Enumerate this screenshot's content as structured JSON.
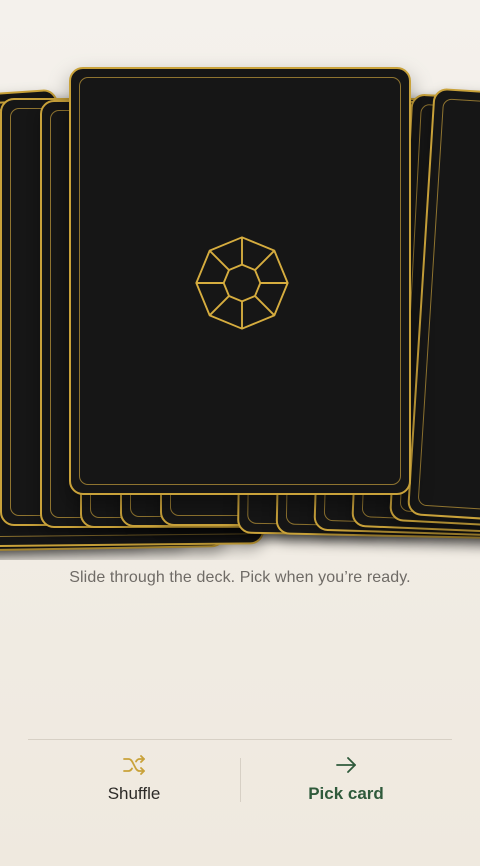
{
  "instruction_text": "Slide through the deck. Pick when you’re ready.",
  "actions": {
    "shuffle_label": "Shuffle",
    "pick_label": "Pick card"
  },
  "colors": {
    "background": "#f2eee7",
    "card_back": "#161616",
    "gold_accent": "#c9a23a",
    "pick_green": "#2f5a3b"
  },
  "icons": {
    "emblem": "octagon-emblem-icon",
    "shuffle": "shuffle-icon",
    "pick": "arrow-right-icon"
  }
}
